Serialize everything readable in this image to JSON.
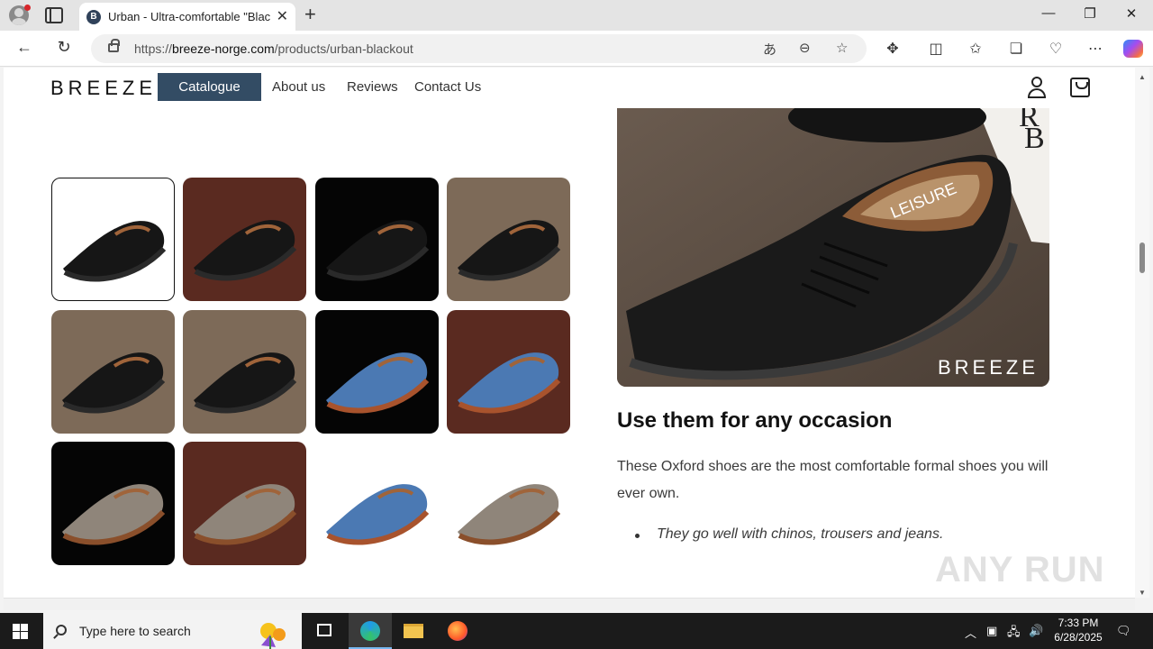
{
  "browser": {
    "tab_title": "Urban - Ultra-comfortable \"Blackout\"",
    "tab_favicon_letter": "B",
    "url_prefix": "https://",
    "url_domain": "breeze-norge.com",
    "url_path": "/products/urban-blackout"
  },
  "site": {
    "logo": "BREEZE",
    "nav": {
      "catalogue": "Catalogue",
      "about": "About us",
      "reviews": "Reviews",
      "contact": "Contact Us"
    },
    "hero_watermark": "BREEZE",
    "section_heading": "Use them for any occasion",
    "description": "These Oxford shoes are the most comfortable formal shoes you will ever own.",
    "bullets": [
      "They go well with chinos, trousers and jeans."
    ],
    "thumbnails": [
      {
        "color": "black",
        "background": "white",
        "selected": true
      },
      {
        "color": "black",
        "background": "brown",
        "selected": false
      },
      {
        "color": "black",
        "background": "black",
        "selected": false
      },
      {
        "color": "black",
        "background": "wood",
        "selected": false
      },
      {
        "color": "black",
        "background": "wood",
        "selected": false
      },
      {
        "color": "black",
        "background": "wood",
        "selected": false
      },
      {
        "color": "blue",
        "background": "black",
        "selected": false
      },
      {
        "color": "blue",
        "background": "brown",
        "selected": false
      },
      {
        "color": "taupe",
        "background": "black",
        "selected": false
      },
      {
        "color": "taupe",
        "background": "brown",
        "selected": false
      },
      {
        "color": "blue",
        "background": "white",
        "selected": false
      },
      {
        "color": "taupe",
        "background": "white",
        "selected": false
      }
    ]
  },
  "overlay_watermark": "ANY RUN",
  "taskbar": {
    "search_placeholder": "Type here to search",
    "time": "7:33 PM",
    "date": "6/28/2025"
  },
  "colors": {
    "nav_active_bg": "#334c64",
    "taskbar_bg": "#1b1b1b"
  }
}
